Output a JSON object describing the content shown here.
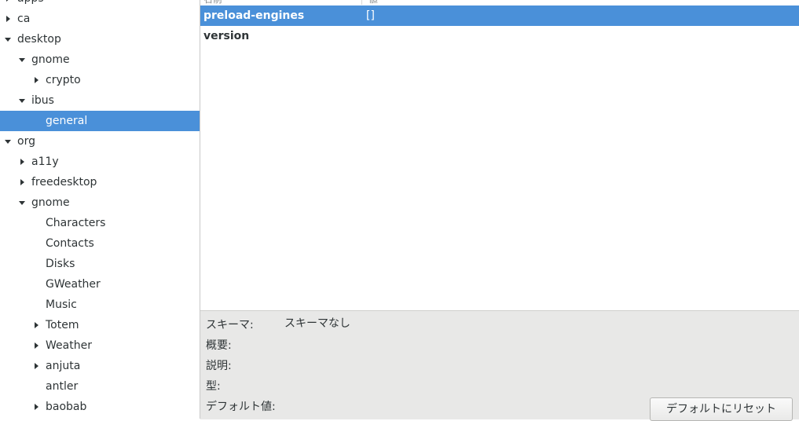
{
  "tree": [
    {
      "label": "apps",
      "depth": 0,
      "expander": "collapsed"
    },
    {
      "label": "ca",
      "depth": 0,
      "expander": "collapsed"
    },
    {
      "label": "desktop",
      "depth": 0,
      "expander": "expanded"
    },
    {
      "label": "gnome",
      "depth": 1,
      "expander": "expanded"
    },
    {
      "label": "crypto",
      "depth": 2,
      "expander": "collapsed"
    },
    {
      "label": "ibus",
      "depth": 1,
      "expander": "expanded"
    },
    {
      "label": "general",
      "depth": 2,
      "expander": "none",
      "selected": true
    },
    {
      "label": "org",
      "depth": 0,
      "expander": "expanded"
    },
    {
      "label": "a11y",
      "depth": 1,
      "expander": "collapsed"
    },
    {
      "label": "freedesktop",
      "depth": 1,
      "expander": "collapsed"
    },
    {
      "label": "gnome",
      "depth": 1,
      "expander": "expanded"
    },
    {
      "label": "Characters",
      "depth": 2,
      "expander": "none"
    },
    {
      "label": "Contacts",
      "depth": 2,
      "expander": "none"
    },
    {
      "label": "Disks",
      "depth": 2,
      "expander": "none"
    },
    {
      "label": "GWeather",
      "depth": 2,
      "expander": "none"
    },
    {
      "label": "Music",
      "depth": 2,
      "expander": "none"
    },
    {
      "label": "Totem",
      "depth": 2,
      "expander": "collapsed"
    },
    {
      "label": "Weather",
      "depth": 2,
      "expander": "collapsed"
    },
    {
      "label": "anjuta",
      "depth": 2,
      "expander": "collapsed"
    },
    {
      "label": "antler",
      "depth": 2,
      "expander": "none"
    },
    {
      "label": "baobab",
      "depth": 2,
      "expander": "collapsed"
    }
  ],
  "keys_table": {
    "headers": {
      "name": "名前",
      "value": "値"
    },
    "rows": [
      {
        "name": "preload-engines",
        "value": "[]",
        "selected": true
      },
      {
        "name": "version",
        "value": ""
      }
    ]
  },
  "info_panel": {
    "schema_label": "スキーマ:",
    "schema_value": "スキーマなし",
    "summary_label": "概要:",
    "description_label": "説明:",
    "type_label": "型:",
    "default_label": "デフォルト値:",
    "reset_button": "デフォルトにリセット"
  },
  "colors": {
    "selection": "#4a90d9",
    "info_background": "#e8e8e7"
  }
}
